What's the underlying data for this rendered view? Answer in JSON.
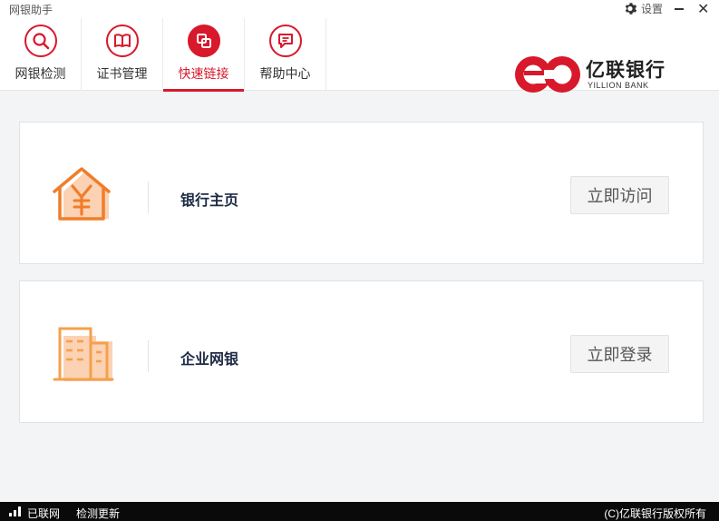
{
  "window": {
    "title": "网银助手",
    "settings_label": "设置",
    "icons": {
      "settings": "gear-icon",
      "minimize": "minimize-icon",
      "close": "close-icon"
    }
  },
  "nav": {
    "tabs": [
      {
        "label": "网银检测",
        "icon": "search-icon",
        "active": false
      },
      {
        "label": "证书管理",
        "icon": "book-icon",
        "active": false
      },
      {
        "label": "快速链接",
        "icon": "link-icon",
        "active": true
      },
      {
        "label": "帮助中心",
        "icon": "chat-icon",
        "active": false
      }
    ]
  },
  "brand": {
    "name": "亿联银行",
    "english": "YILLION BANK",
    "color": "#d8182b"
  },
  "links": [
    {
      "title": "银行主页",
      "button": "立即访问",
      "icon": "bank-house-icon"
    },
    {
      "title": "企业网银",
      "button": "立即登录",
      "icon": "office-building-icon"
    }
  ],
  "status": {
    "network": "已联网",
    "update": "检测更新",
    "copyright": "(C)亿联银行版权所有"
  },
  "colors": {
    "accent": "#d8182b",
    "icon_orange": "#f07d2a"
  }
}
